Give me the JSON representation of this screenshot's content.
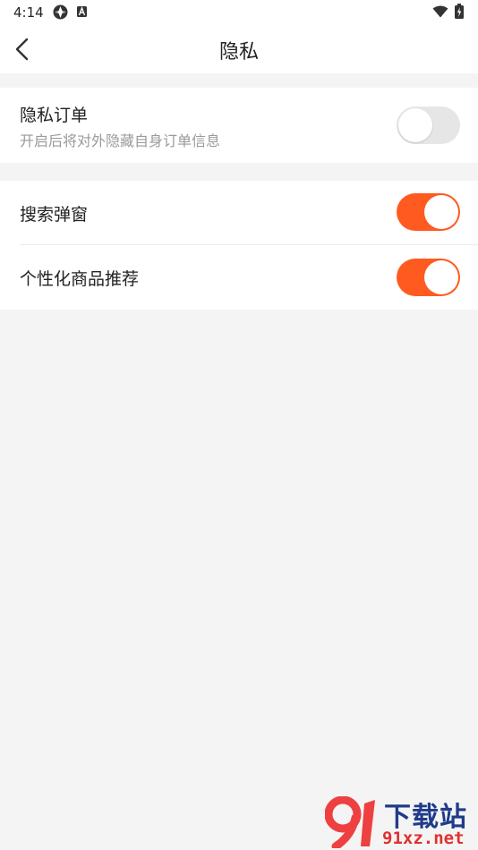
{
  "status_bar": {
    "time": "4:14",
    "icons": [
      "app-notification-icon",
      "a-notification-icon",
      "wifi-icon",
      "battery-icon"
    ]
  },
  "header": {
    "title": "隐私",
    "back_icon": "chevron-left-icon"
  },
  "settings": {
    "private_order": {
      "title": "隐私订单",
      "subtitle": "开启后将对外隐藏自身订单信息",
      "enabled": false
    },
    "search_popup": {
      "title": "搜索弹窗",
      "enabled": true
    },
    "personalized_recommend": {
      "title": "个性化商品推荐",
      "enabled": true
    }
  },
  "colors": {
    "accent": "#ff5a1f",
    "toggle_off": "#e6e6e6",
    "page_background": "#f4f4f4"
  },
  "watermark": {
    "title": "下载站",
    "url": "91xz.net"
  }
}
